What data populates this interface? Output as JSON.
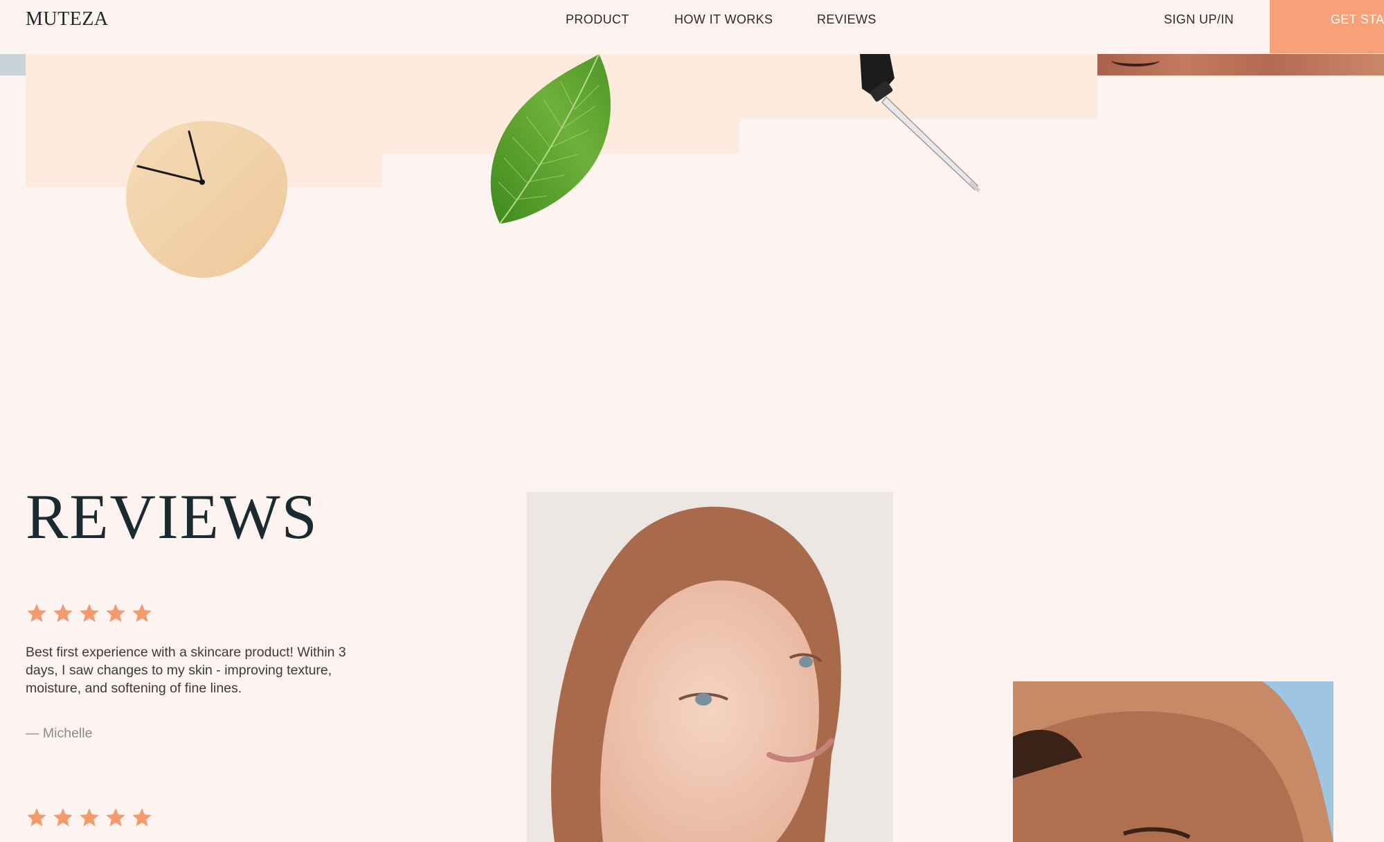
{
  "header": {
    "logo": "MUTEZA",
    "nav": {
      "product": "PRODUCT",
      "how_it_works": "HOW IT WORKS",
      "reviews": "REVIEWS"
    },
    "sign_in": "SIGN UP/IN",
    "cta_label": "GET STAR"
  },
  "reviews": {
    "title": "REVIEWS",
    "items": [
      {
        "rating": 5,
        "text": "Best first experience with a skincare product! Within 3 days, I saw changes to my skin - improving texture, moisture, and softening of fine lines.",
        "author": "— Michelle"
      },
      {
        "rating": 5
      }
    ]
  },
  "colors": {
    "background": "#fdf4f1",
    "accent": "#f8a077",
    "star": "#f59a6c",
    "heading": "#1b2a30",
    "panel": "#fdebde"
  }
}
